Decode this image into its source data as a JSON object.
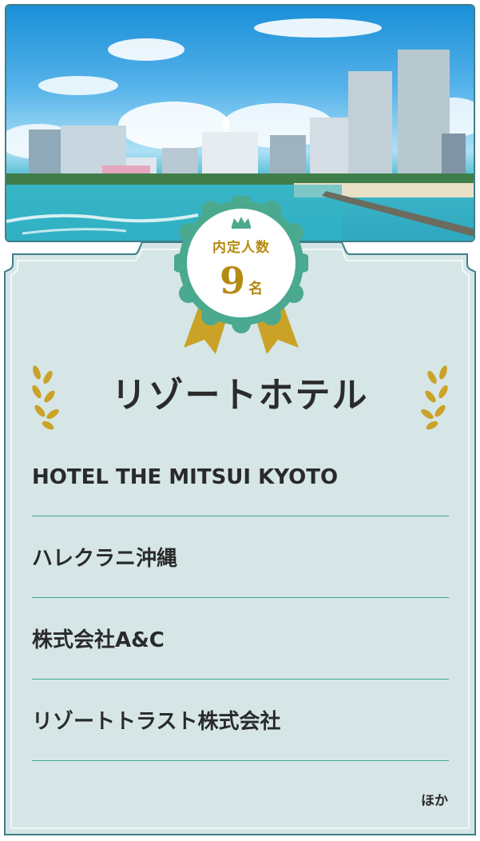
{
  "badge": {
    "label": "内定人数",
    "count": "9",
    "unit": "名",
    "icon": "crown-icon"
  },
  "category": {
    "title": "リゾートホテル"
  },
  "companies": [
    "HOTEL THE MITSUI KYOTO",
    "ハレクラニ沖縄",
    "株式会社A&C",
    "リゾートトラスト株式会社"
  ],
  "others_label": "ほか",
  "colors": {
    "card_background": "#d6e6e7",
    "border": "#3c7f88",
    "badge_green": "#4aa98f",
    "badge_gold": "#c9a227",
    "divider": "#3fa593",
    "text": "#2a2a2a"
  }
}
